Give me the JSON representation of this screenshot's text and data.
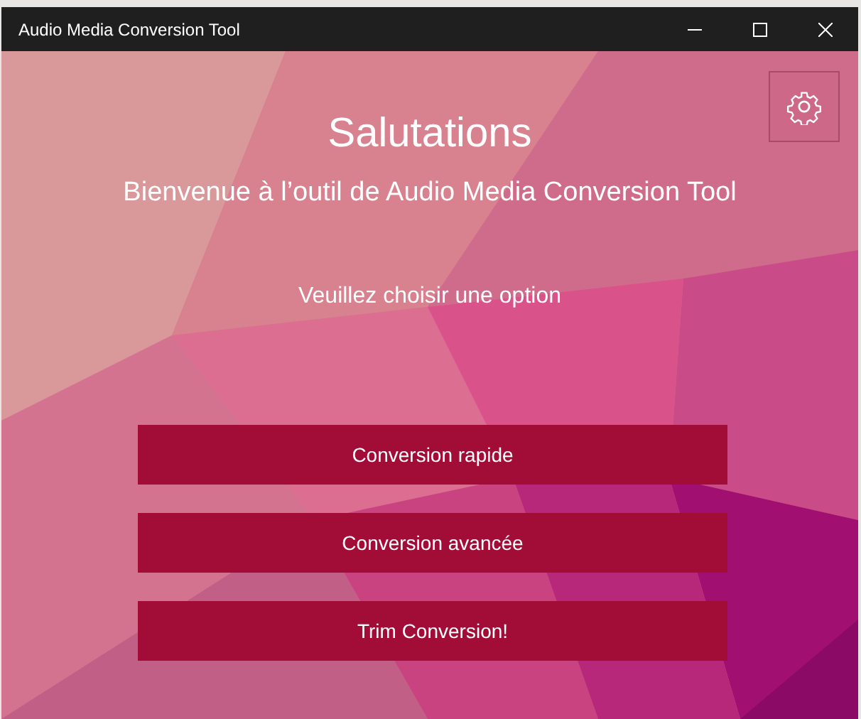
{
  "window": {
    "title": "Audio Media Conversion Tool"
  },
  "header": {
    "title": "Salutations",
    "subtitle": "Bienvenue à l’outil de Audio Media Conversion Tool"
  },
  "prompt": "Veuillez choisir une option",
  "options": [
    "Conversion rapide",
    "Conversion avancée",
    "Trim Conversion!"
  ]
}
